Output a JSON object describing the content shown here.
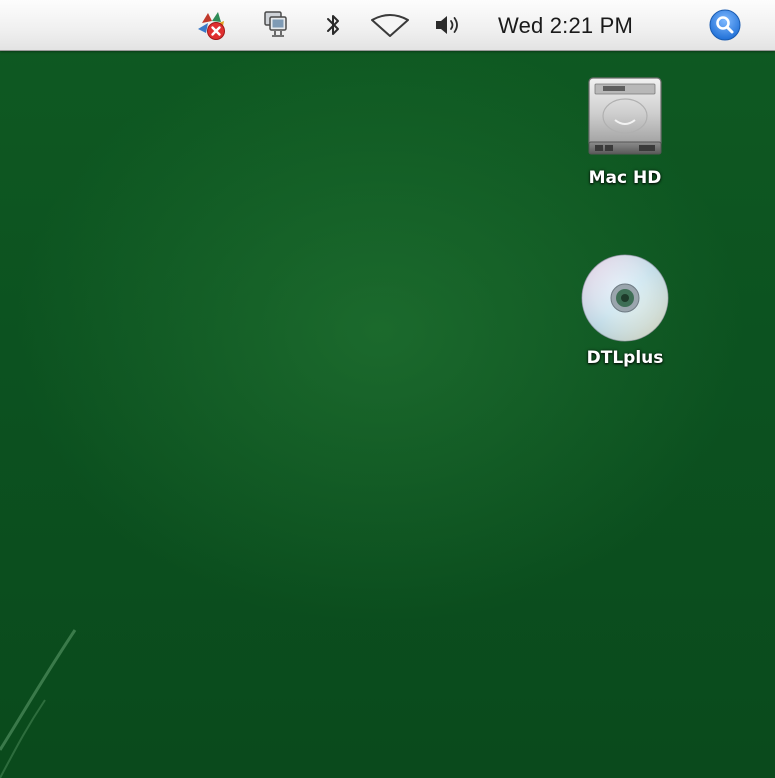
{
  "menubar": {
    "extras": [
      {
        "icon": "status-menu-error-icon",
        "accent": "#e03030"
      },
      {
        "icon": "display-mirroring-icon"
      },
      {
        "icon": "bluetooth-icon"
      },
      {
        "icon": "wifi-icon"
      },
      {
        "icon": "volume-icon"
      }
    ],
    "clock": "Wed 2:21 PM",
    "spotlight_icon": "spotlight-search-icon",
    "spotlight_color": "#2a7de1"
  },
  "desktop": {
    "background_color": "#0d5420",
    "icons": [
      {
        "label": "Mac HD",
        "icon": "hard-drive-icon"
      },
      {
        "label": "DTLplus",
        "icon": "optical-disc-icon"
      }
    ]
  }
}
